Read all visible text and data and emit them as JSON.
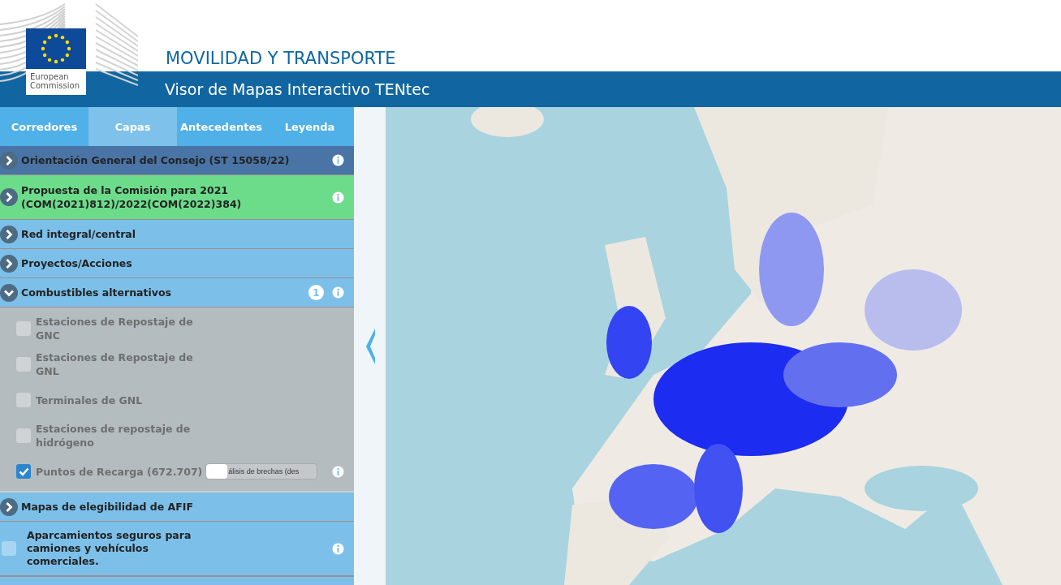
{
  "header": {
    "logo_text": "European Commission",
    "title": "MOVILIDAD Y TRANSPORTE",
    "subtitle": "Visor de Mapas Interactivo TENtec"
  },
  "tabs": [
    {
      "label": "Corredores",
      "selected": false
    },
    {
      "label": "Capas",
      "selected": true
    },
    {
      "label": "Antecedentes",
      "selected": false
    },
    {
      "label": "Leyenda",
      "selected": false
    }
  ],
  "layers": [
    {
      "kind": "group",
      "label": "Orientación General del Consejo (ST 15058/22)",
      "color": "#4a74a6",
      "expanded": false,
      "info": true
    },
    {
      "kind": "group",
      "label": "Propuesta de la Comisión para 2021 (COM(2021)812)/2022(COM(2022)384)",
      "color": "#6cdc8b",
      "expanded": false,
      "info": true
    },
    {
      "kind": "group",
      "label": "Red integral/central",
      "color": "#7cc0ea",
      "expanded": false,
      "info": false
    },
    {
      "kind": "group",
      "label": "Proyectos/Acciones",
      "color": "#7cc0ea",
      "expanded": false,
      "info": false
    },
    {
      "kind": "group",
      "label": "Combustibles alternativos",
      "color": "#7cc0ea",
      "expanded": true,
      "info": true,
      "badge": "1",
      "children": [
        {
          "label": "Estaciones de Repostaje de GNC",
          "checked": false
        },
        {
          "label": "Estaciones de Repostaje de GNL",
          "checked": false
        },
        {
          "label": "Terminales de GNL",
          "checked": false
        },
        {
          "label": "Estaciones de repostaje de hidrógeno",
          "checked": false
        },
        {
          "label": "Puntos de Recarga (672.707)",
          "checked": true,
          "toggle": {
            "label": "álisis de brechas (des",
            "on": false
          },
          "info": true
        }
      ]
    },
    {
      "kind": "group",
      "label": "Mapas de elegibilidad de AFIF",
      "color": "#7cc0ea",
      "expanded": false,
      "info": false
    },
    {
      "kind": "checkbox",
      "label": "Aparcamientos seguros para camiones y vehículos comerciales.",
      "color": "#7cc0ea",
      "checked": false,
      "info": true
    }
  ]
}
